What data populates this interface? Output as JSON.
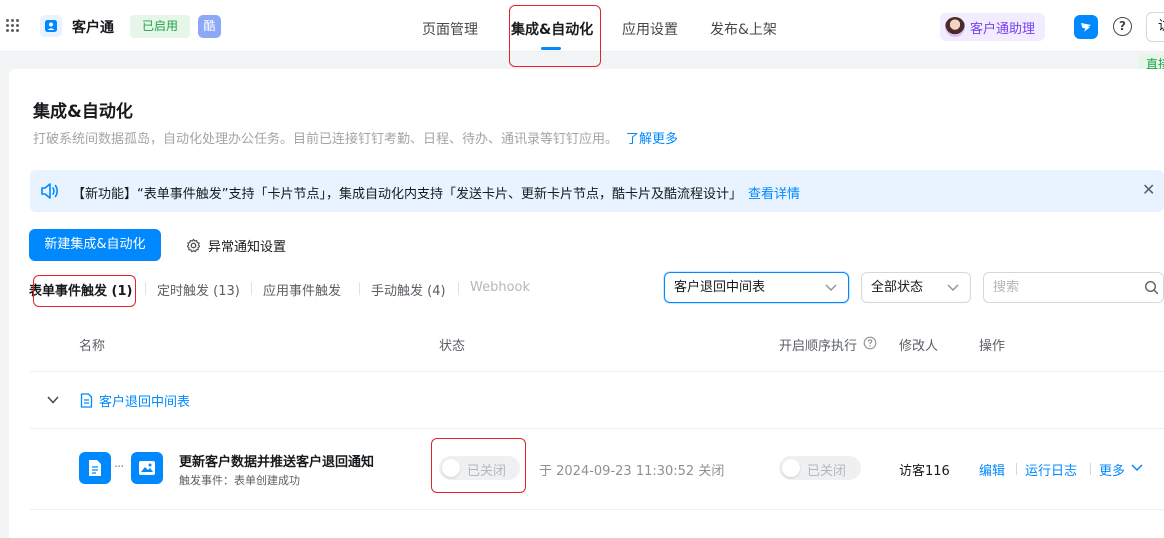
{
  "app": {
    "name": "客户通",
    "status_badge": "已启用",
    "ku_badge": "酷"
  },
  "nav": {
    "tabs": [
      {
        "label": "页面管理"
      },
      {
        "label": "集成&自动化"
      },
      {
        "label": "应用设置"
      },
      {
        "label": "发布&上架"
      }
    ],
    "active_tab": "集成&自动化"
  },
  "header_right": {
    "assistant_label": "客户通助理",
    "help_symbol": "?",
    "cut_button_text": "访",
    "cut_green_text": "直接"
  },
  "page": {
    "title": "集成&自动化",
    "description": "打破系统间数据孤岛，自动化处理办公任务。目前已连接钉钉考勤、日程、待办、通讯录等钉钉应用。",
    "learn_more": "了解更多"
  },
  "notice": {
    "text": "【新功能】“表单事件触发”支持「卡片节点」，集成自动化内支持「发送卡片、更新卡片节点，酷卡片及酷流程设计」",
    "link": "查看详情",
    "close": "✕"
  },
  "actions": {
    "new_button": "新建集成&自动化",
    "abnormal_settings": "异常通知设置"
  },
  "sub_tabs": [
    {
      "label": "表单事件触发 (1)"
    },
    {
      "label": "定时触发 (13)"
    },
    {
      "label": "应用事件触发"
    },
    {
      "label": "手动触发 (4)"
    },
    {
      "label": "Webhook"
    }
  ],
  "filters": {
    "form_select_value": "客户退回中间表",
    "status_select_value": "全部状态",
    "search_placeholder": "搜索"
  },
  "table": {
    "headers": {
      "name": "名称",
      "status": "状态",
      "sequential": "开启顺序执行",
      "modifier": "修改人",
      "ops": "操作"
    },
    "group": {
      "label": "客户退回中间表",
      "expanded": true
    },
    "rows": [
      {
        "title": "更新客户数据并推送客户退回通知",
        "trigger": "触发事件：表单创建成功",
        "status_toggle": "已关闭",
        "closed_time": "于 2024-09-23 11:30:52 关闭",
        "sequential_toggle": "已关闭",
        "modifier": "访客116",
        "ops": {
          "edit": "编辑",
          "log": "运行日志",
          "more": "更多"
        }
      }
    ]
  },
  "colors": {
    "accent": "#0089ff",
    "highlight_box": "#e0242a",
    "enabled_green": "#1aa34a",
    "assistant_purple": "#7a3ff0"
  }
}
